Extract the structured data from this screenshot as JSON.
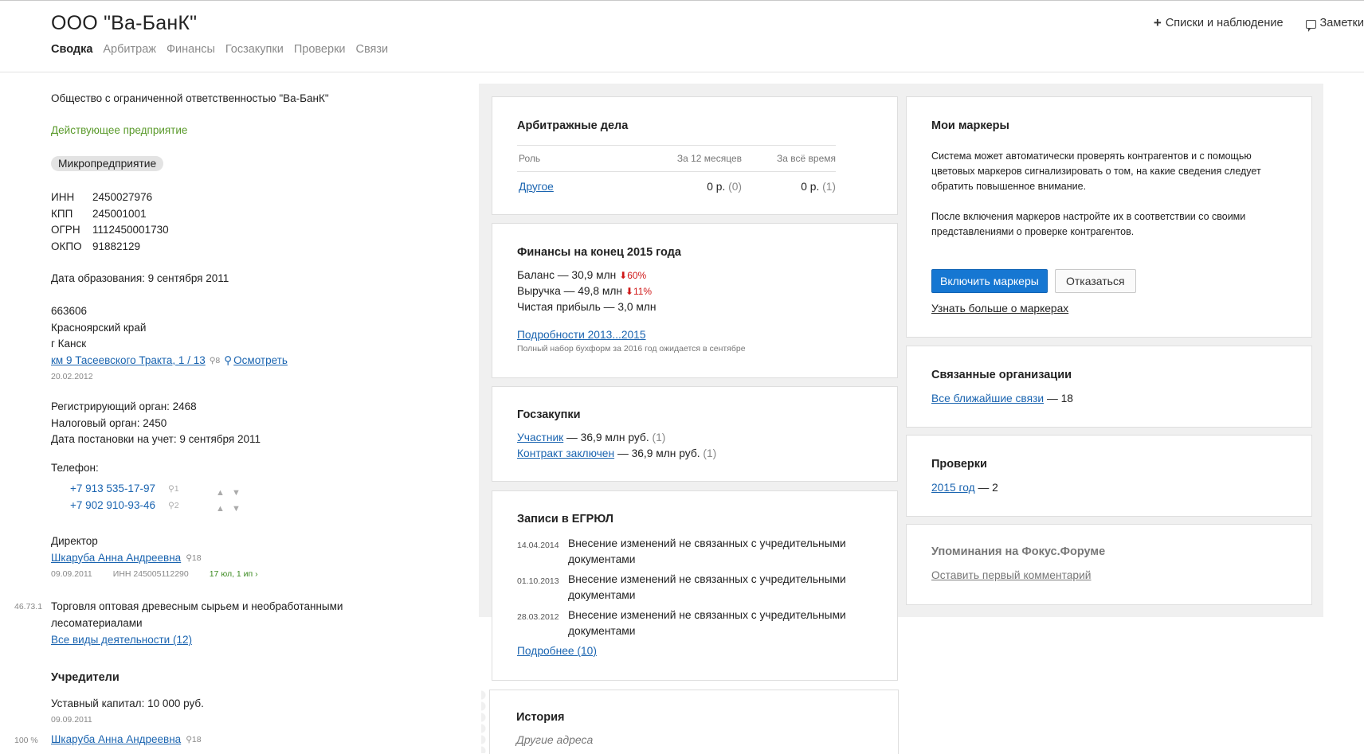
{
  "header": {
    "title": "ООО \"Ва-БанК\"",
    "tabs": [
      {
        "label": "Сводка"
      },
      {
        "label": "Арбитраж"
      },
      {
        "label": "Финансы"
      },
      {
        "label": "Госзакупки"
      },
      {
        "label": "Проверки"
      },
      {
        "label": "Связи"
      }
    ],
    "actions": {
      "lists_label": "Списки и наблюдение",
      "notes_label": "Заметки"
    }
  },
  "left": {
    "full_name": "Общество с ограниченной ответственностью \"Ва-БанК\"",
    "status": "Действующее предприятие",
    "badge": "Микропредприятие",
    "ids": [
      {
        "label": "ИНН",
        "value": "2450027976"
      },
      {
        "label": "КПП",
        "value": "245001001"
      },
      {
        "label": "ОГРН",
        "value": "1112450001730"
      },
      {
        "label": "ОКПО",
        "value": "91882129"
      }
    ],
    "formation_date": "Дата образования: 9 сентября 2011",
    "address": {
      "postcode": "663606",
      "region": "Красноярский край",
      "city": "г Канск",
      "street": "км 9 Тасеевского Тракта, 1 / 13",
      "street_count": "8",
      "view_label": "Осмотреть",
      "date": "20.02.2012"
    },
    "registry": {
      "reg_organ": "Регистрирующий орган: 2468",
      "tax_organ": "Налоговый орган: 2450",
      "reg_date": "Дата постановки на учет: 9 сентября 2011"
    },
    "phones": {
      "label": "Телефон:",
      "items": [
        {
          "number": "+7 913 535-17-97",
          "count": "1"
        },
        {
          "number": "+7 902 910-93-46",
          "count": "2"
        }
      ]
    },
    "director": {
      "label": "Директор",
      "name": "Шкаруба Анна Андреевна",
      "count": "18",
      "date": "09.09.2011",
      "inn": "ИНН 245005112290",
      "links": "17 юл, 1 ип"
    },
    "activity": {
      "code": "46.73.1",
      "text_line1": "Торговля оптовая древесным сырьем и необработанными",
      "text_line2": "лесоматериалами",
      "all_link": "Все виды деятельности (12)"
    },
    "founders": {
      "title": "Учредители",
      "capital": "Уставный капитал: 10 000 руб.",
      "date": "09.09.2011",
      "share": "100 %",
      "name": "Шкаруба Анна Андреевна",
      "count": "18"
    }
  },
  "arbitration": {
    "title": "Арбитражные дела",
    "columns": [
      "Роль",
      "За 12 месяцев",
      "За всё время"
    ],
    "row": {
      "role": "Другое",
      "m12": "0 р.",
      "m12_count": "(0)",
      "all": "0 р.",
      "all_count": "(1)"
    }
  },
  "finance": {
    "title": "Финансы на конец 2015 года",
    "balance": "Баланс — 30,9 млн",
    "balance_change": "60%",
    "revenue": "Выручка — 49,8 млн",
    "revenue_change": "11%",
    "profit": "Чистая прибыль — 3,0 млн",
    "details_link": "Подробности 2013...2015",
    "note": "Полный набор бухформ за 2016 год ожидается в сентябре"
  },
  "procurement": {
    "title": "Госзакупки",
    "rows": [
      {
        "link": "Участник",
        "text": " — 36,9 млн руб.",
        "count": "(1)"
      },
      {
        "link": "Контракт заключен",
        "text": " — 36,9 млн руб.",
        "count": "(1)"
      }
    ]
  },
  "egrul": {
    "title": "Записи в ЕГРЮЛ",
    "rows": [
      {
        "date": "14.04.2014",
        "text": "Внесение изменений не связанных с учредительными документами"
      },
      {
        "date": "01.10.2013",
        "text": "Внесение изменений не связанных с учредительными документами"
      },
      {
        "date": "28.03.2012",
        "text": "Внесение изменений не связанных с учредительными документами"
      }
    ],
    "more_link": "Подробнее (10)"
  },
  "history": {
    "title": "История",
    "subtitle": "Другие адреса"
  },
  "markers": {
    "title": "Мои маркеры",
    "para1": "Система может автоматически проверять контрагентов и с помощью цветовых маркеров сигнализировать о том, на какие сведения следует обратить повышенное внимание.",
    "para2": "После включения маркеров настройте их в соответствии со своими представлениями о проверке контрагентов.",
    "enable_label": "Включить маркеры",
    "decline_label": "Отказаться",
    "learn_link": "Узнать больше о маркерах"
  },
  "related": {
    "title": "Связанные организации",
    "link": "Все ближайшие связи",
    "count": " — 18"
  },
  "inspections": {
    "title": "Проверки",
    "link": "2015 год",
    "count": " — 2"
  },
  "forum": {
    "title": "Упоминания на Фокус.Форуме",
    "link": "Оставить первый комментарий"
  }
}
